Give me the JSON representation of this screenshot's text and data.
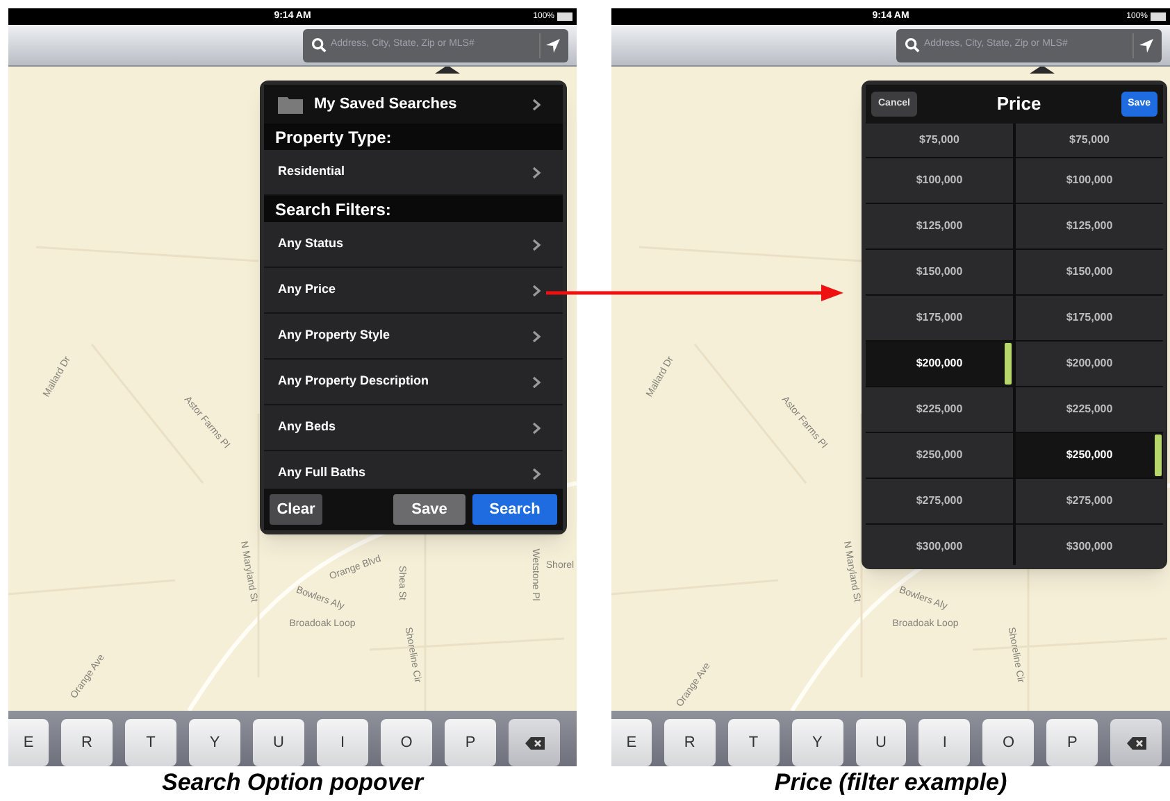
{
  "panels": [
    {
      "kind": "menu",
      "status_bar": {
        "time": "9:14 AM",
        "battery": "100%"
      },
      "search": {
        "placeholder": "Address, City, State, Zip or MLS#"
      },
      "map_labels": [
        "Mallard Dr",
        "Astor Farms Pl",
        "N Maryland St",
        "Orange Blvd",
        "Shea St",
        "Bowlers Aly",
        "Broadoak Loop",
        "Shoreline Cir",
        "Wetstone Pl",
        "Shorel",
        "Orange Ave"
      ],
      "popover": {
        "rows": [
          {
            "kind": "folder",
            "label": "My Saved Searches"
          },
          {
            "kind": "header",
            "label": "Property Type:"
          },
          {
            "kind": "item",
            "label": "Residential"
          },
          {
            "kind": "header",
            "label": "Search Filters:"
          },
          {
            "kind": "item",
            "label": "Any Status"
          },
          {
            "kind": "item",
            "label": "Any Price"
          },
          {
            "kind": "item",
            "label": "Any Property Style"
          },
          {
            "kind": "item",
            "label": "Any Property Description"
          },
          {
            "kind": "item",
            "label": "Any Beds"
          },
          {
            "kind": "item",
            "label": "Any Full Baths"
          }
        ],
        "buttons": [
          {
            "kind": "plain",
            "label": "Clear"
          },
          {
            "kind": "secondary",
            "label": "Save"
          },
          {
            "kind": "primary",
            "label": "Search"
          }
        ]
      },
      "keyboard": [
        "E",
        "R",
        "T",
        "Y",
        "U",
        "I",
        "O",
        "P"
      ],
      "caption": "Search Option popover"
    },
    {
      "kind": "picker",
      "status_bar": {
        "time": "9:14 AM",
        "battery": "100%"
      },
      "search": {
        "placeholder": "Address, City, State, Zip or MLS#"
      },
      "map_labels": [
        "Mallard Dr",
        "Astor Farms Pl",
        "N Maryland St",
        "Bowlers Aly",
        "Broadoak Loop",
        "Shoreline Cir",
        "Orange Ave"
      ],
      "popover": {
        "cancel": "Cancel",
        "title": "Price",
        "save": "Save",
        "columns": [
          {
            "options": [
              {
                "label": "$75,000",
                "selected": false
              },
              {
                "label": "$100,000",
                "selected": false
              },
              {
                "label": "$125,000",
                "selected": false
              },
              {
                "label": "$150,000",
                "selected": false
              },
              {
                "label": "$175,000",
                "selected": false
              },
              {
                "label": "$200,000",
                "selected": true
              },
              {
                "label": "$225,000",
                "selected": false
              },
              {
                "label": "$250,000",
                "selected": false
              },
              {
                "label": "$275,000",
                "selected": false
              },
              {
                "label": "$300,000",
                "selected": false
              }
            ]
          },
          {
            "options": [
              {
                "label": "$75,000",
                "selected": false
              },
              {
                "label": "$100,000",
                "selected": false
              },
              {
                "label": "$125,000",
                "selected": false
              },
              {
                "label": "$150,000",
                "selected": false
              },
              {
                "label": "$175,000",
                "selected": false
              },
              {
                "label": "$200,000",
                "selected": false
              },
              {
                "label": "$225,000",
                "selected": false
              },
              {
                "label": "$250,000",
                "selected": true
              },
              {
                "label": "$275,000",
                "selected": false
              },
              {
                "label": "$300,000",
                "selected": false
              }
            ]
          }
        ]
      },
      "keyboard": [
        "E",
        "R",
        "T",
        "Y",
        "U",
        "I",
        "O",
        "P"
      ],
      "caption": "Price (filter example)"
    }
  ]
}
